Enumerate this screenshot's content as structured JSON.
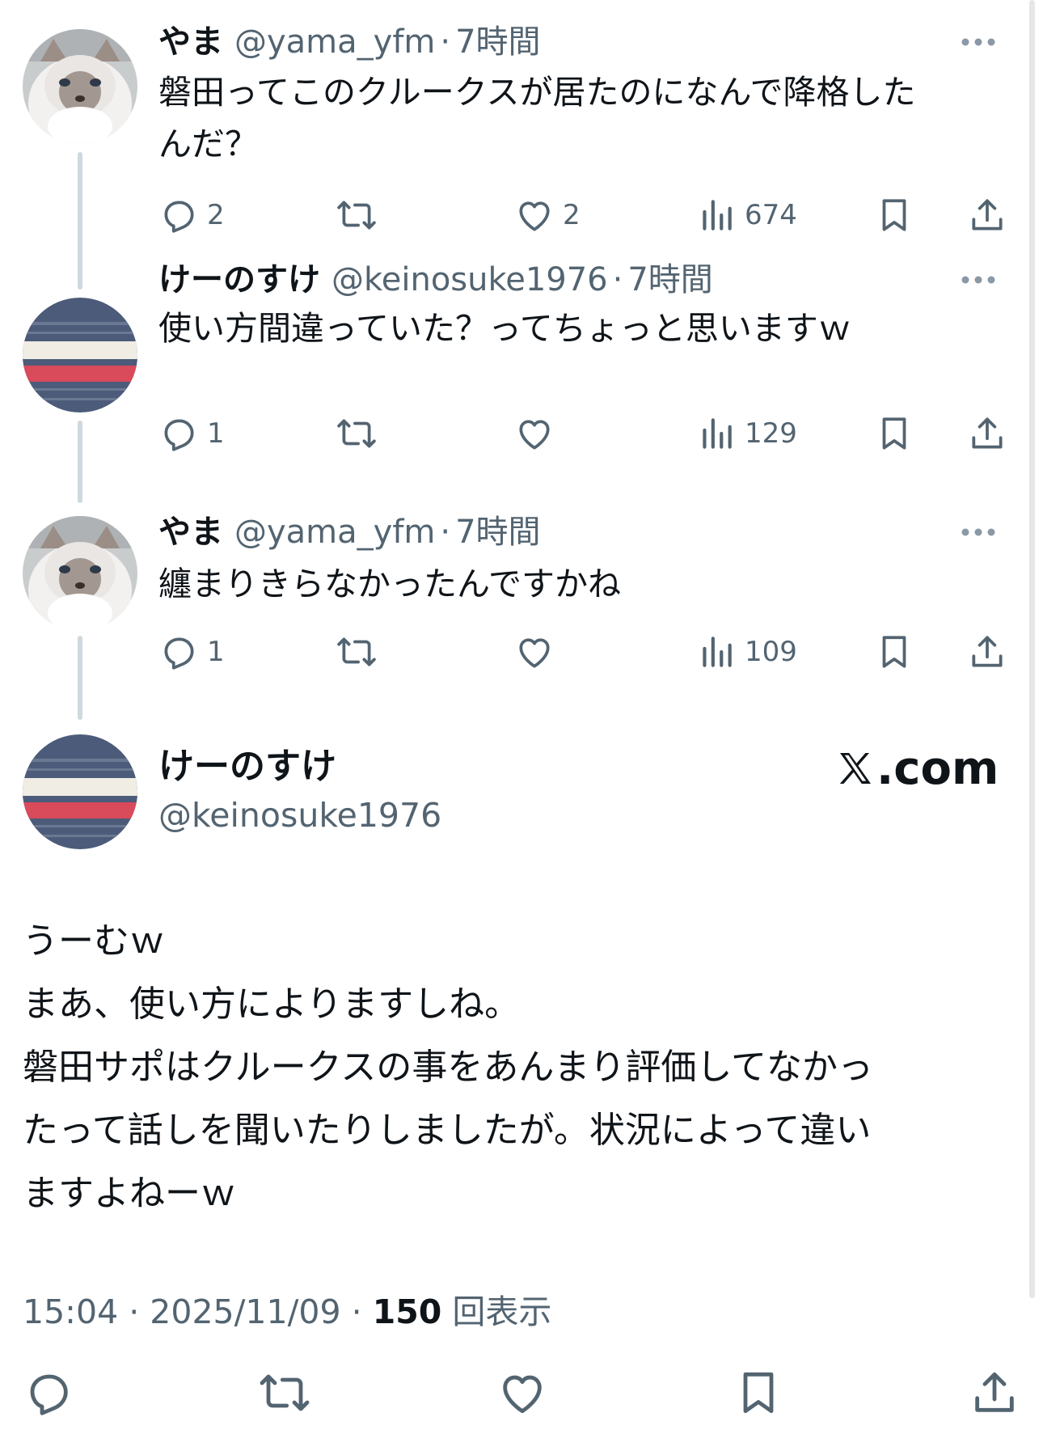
{
  "replies": [
    {
      "name": "やま",
      "handle": "@yama_yfm",
      "sep": "·",
      "time": "7時間",
      "text_lines": [
        "磐田ってこのクルークスが居たのになんで降格した",
        "んだ？"
      ],
      "avatar": "cat-avatar",
      "replies": "2",
      "likes": "2",
      "views": "674"
    },
    {
      "name": "けーのすけ",
      "handle": "@keinosuke1976",
      "sep": "·",
      "time": "7時間",
      "text_lines": [
        "使い方間違っていた？ってちょっと思いますｗ"
      ],
      "avatar": "striped-avatar",
      "replies": "1",
      "likes": "",
      "views": "129"
    },
    {
      "name": "やま",
      "handle": "@yama_yfm",
      "sep": "·",
      "time": "7時間",
      "text_lines": [
        "纏まりきらなかったんですかね"
      ],
      "avatar": "cat-avatar",
      "replies": "1",
      "likes": "",
      "views": "109"
    }
  ],
  "main": {
    "name": "けーのすけ",
    "handle": "@keinosuke1976",
    "brand": ".com",
    "text_lines": [
      "うーむｗ",
      "まあ、使い方によりますしね。",
      "磐田サポはクルークスの事をあんまり評価してなかっ",
      "たって話しを聞いたりしましたが。状況によって違い",
      "ますよねーｗ"
    ],
    "time": "15:04",
    "date": "2025/11/09",
    "views": "150",
    "views_suffix": "回表示"
  },
  "colors": {
    "text": "#0f1419",
    "secondary": "#536471",
    "thread_line": "#cfd9de",
    "stripe_red": "#d94a5b",
    "stripe_navy": "#4a5a78"
  },
  "icons": [
    "reply-icon",
    "retweet-icon",
    "like-icon",
    "views-icon",
    "bookmark-icon",
    "share-icon",
    "more-icon",
    "x-logo-icon"
  ]
}
